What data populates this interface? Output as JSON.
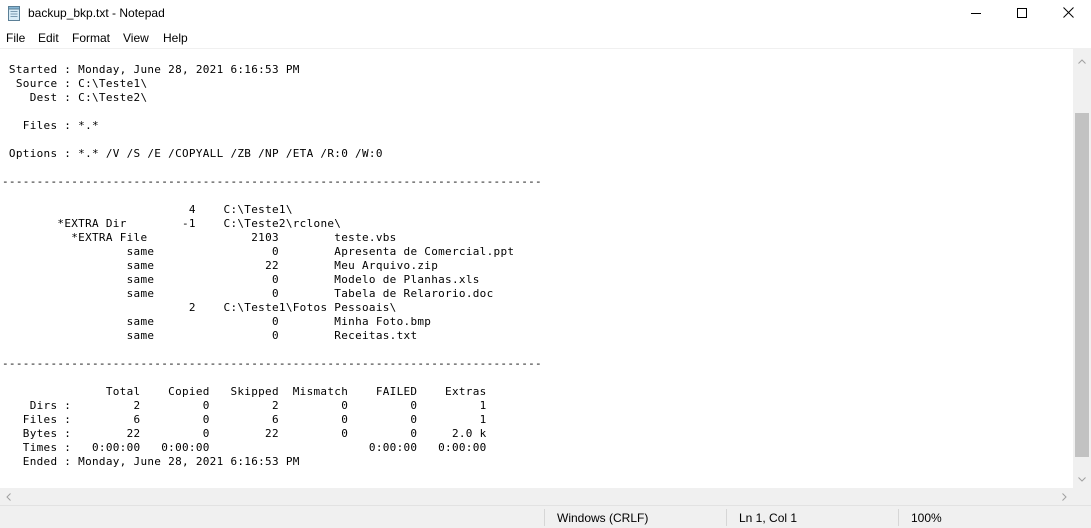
{
  "window": {
    "title": "backup_bkp.txt - Notepad",
    "icons": {
      "app": "notepad-icon",
      "minimize": "minimize-icon",
      "maximize": "maximize-icon",
      "close": "close-icon"
    }
  },
  "menu": {
    "file": "File",
    "edit": "Edit",
    "format": "Format",
    "view": "View",
    "help": "Help"
  },
  "document": {
    "lines": [
      " Started : Monday, June 28, 2021 6:16:53 PM",
      "  Source : C:\\Teste1\\",
      "    Dest : C:\\Teste2\\",
      "",
      "   Files : *.*",
      "",
      " Options : *.* /V /S /E /COPYALL /ZB /NP /ETA /R:0 /W:0",
      "",
      "------------------------------------------------------------------------------",
      "",
      "\t                   4\tC:\\Teste1\\",
      "\t*EXTRA Dir        -1\tC:\\Teste2\\rclone\\",
      "\t  *EXTRA File \t\t    2103\tteste.vbs",
      "\t\t  same\t\t       0\tApresenta de Comercial.ppt",
      "\t\t  same\t\t      22\tMeu Arquivo.zip",
      "\t\t  same\t\t       0\tModelo de Planhas.xls",
      "\t\t  same\t\t       0\tTabela de Relarorio.doc",
      "\t                   2\tC:\\Teste1\\Fotos Pessoais\\",
      "\t\t  same\t\t       0\tMinha Foto.bmp",
      "\t\t  same\t\t       0\tReceitas.txt",
      "",
      "------------------------------------------------------------------------------",
      "",
      "               Total    Copied   Skipped  Mismatch    FAILED    Extras",
      "    Dirs :         2         0         2         0         0         1",
      "   Files :         6         0         6         0         0         1",
      "   Bytes :        22         0        22         0         0     2.0 k",
      "   Times :   0:00:00   0:00:00                       0:00:00   0:00:00",
      "   Ended : Monday, June 28, 2021 6:16:53 PM"
    ]
  },
  "scrollbars": {
    "icons": {
      "up": "arrow-up-icon",
      "down": "arrow-down-icon",
      "left": "arrow-left-icon",
      "right": "arrow-right-icon"
    }
  },
  "status": {
    "line_ending": "Windows (CRLF)",
    "position": "Ln 1, Col 1",
    "zoom": "100%"
  }
}
